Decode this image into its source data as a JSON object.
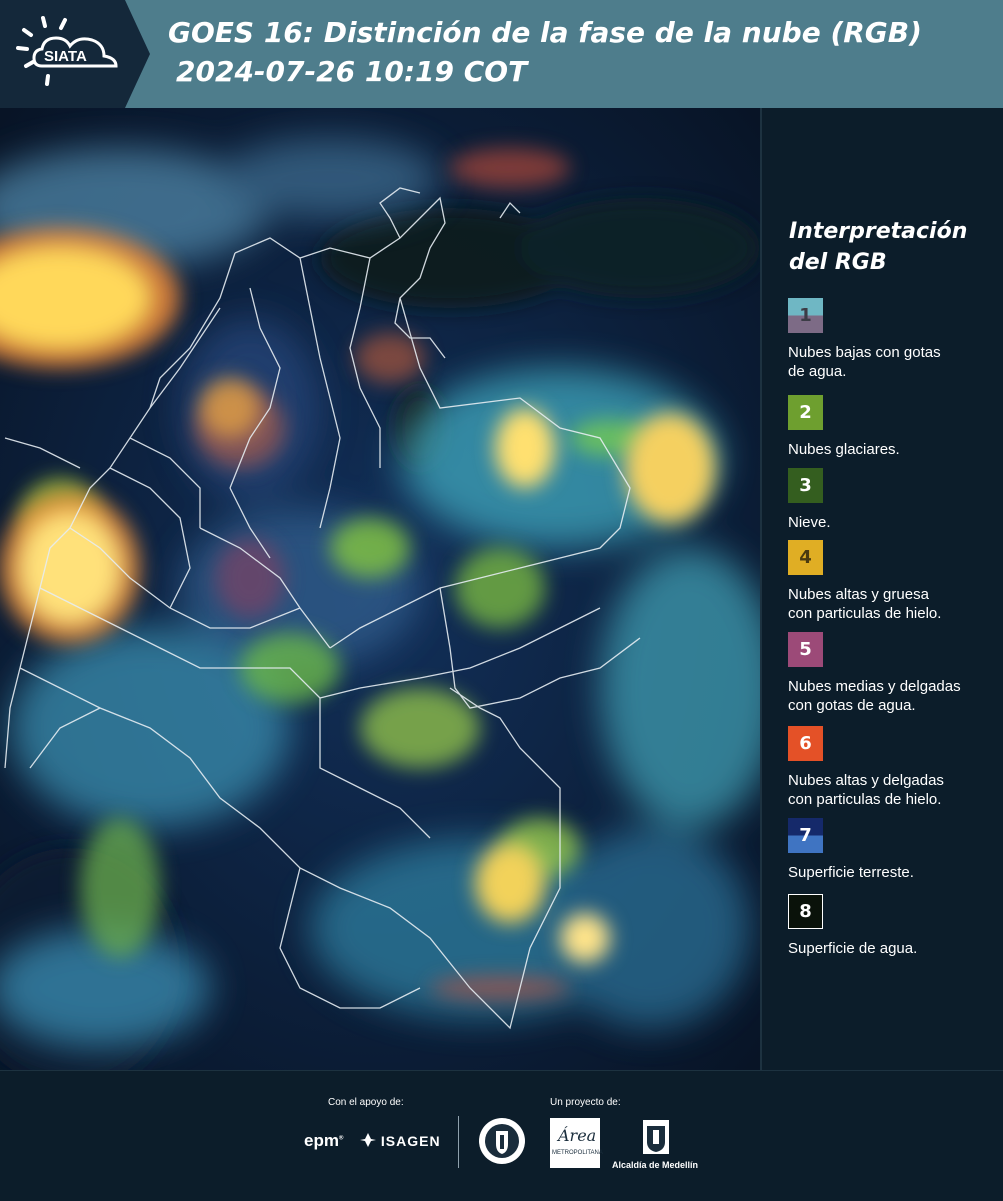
{
  "header": {
    "logo_text": "SIATA",
    "title_line1": "GOES 16: Distinción de la fase de la nube (RGB)",
    "title_line2": "2024-07-26 10:19 COT"
  },
  "legend": {
    "title_line1": "Interpretación",
    "title_line2": "del RGB",
    "items": [
      {
        "number": "1",
        "label_line1": "Nubes bajas con gotas",
        "label_line2": "de agua.",
        "color_top": "#6fb7c4",
        "color_bottom": "#7d6b86"
      },
      {
        "number": "2",
        "label_line1": "Nubes glaciares.",
        "label_line2": "",
        "color_top": "#6e9f2f",
        "color_bottom": "#6e9f2f"
      },
      {
        "number": "3",
        "label_line1": "Nieve.",
        "label_line2": "",
        "color_top": "#345e1f",
        "color_bottom": "#345e1f"
      },
      {
        "number": "4",
        "label_line1": "Nubes altas y gruesa",
        "label_line2": "con particulas de hielo.",
        "color_top": "#e0ae24",
        "color_bottom": "#e0ae24"
      },
      {
        "number": "5",
        "label_line1": "Nubes medias y delgadas",
        "label_line2": "con gotas de agua.",
        "color_top": "#9c4a78",
        "color_bottom": "#9c4a78"
      },
      {
        "number": "6",
        "label_line1": "Nubes altas y delgadas",
        "label_line2": "con particulas de hielo.",
        "color_top": "#e45127",
        "color_bottom": "#e45127"
      },
      {
        "number": "7",
        "label_line1": "Superficie terreste.",
        "label_line2": "",
        "color_top": "#15296a",
        "color_bottom": "#3f74c2"
      },
      {
        "number": "8",
        "label_line1": "Superficie de agua.",
        "label_line2": "",
        "color_top": "#0a120a",
        "color_bottom": "#0a120a"
      }
    ]
  },
  "footer": {
    "support_label": "Con el apoyo de:",
    "project_label": "Un proyecto de:",
    "epm": "epm",
    "isagen": "ISAGEN",
    "area": "Área",
    "area_sub": "METROPOLITANA",
    "alcaldia": "Alcaldía de Medellín"
  }
}
